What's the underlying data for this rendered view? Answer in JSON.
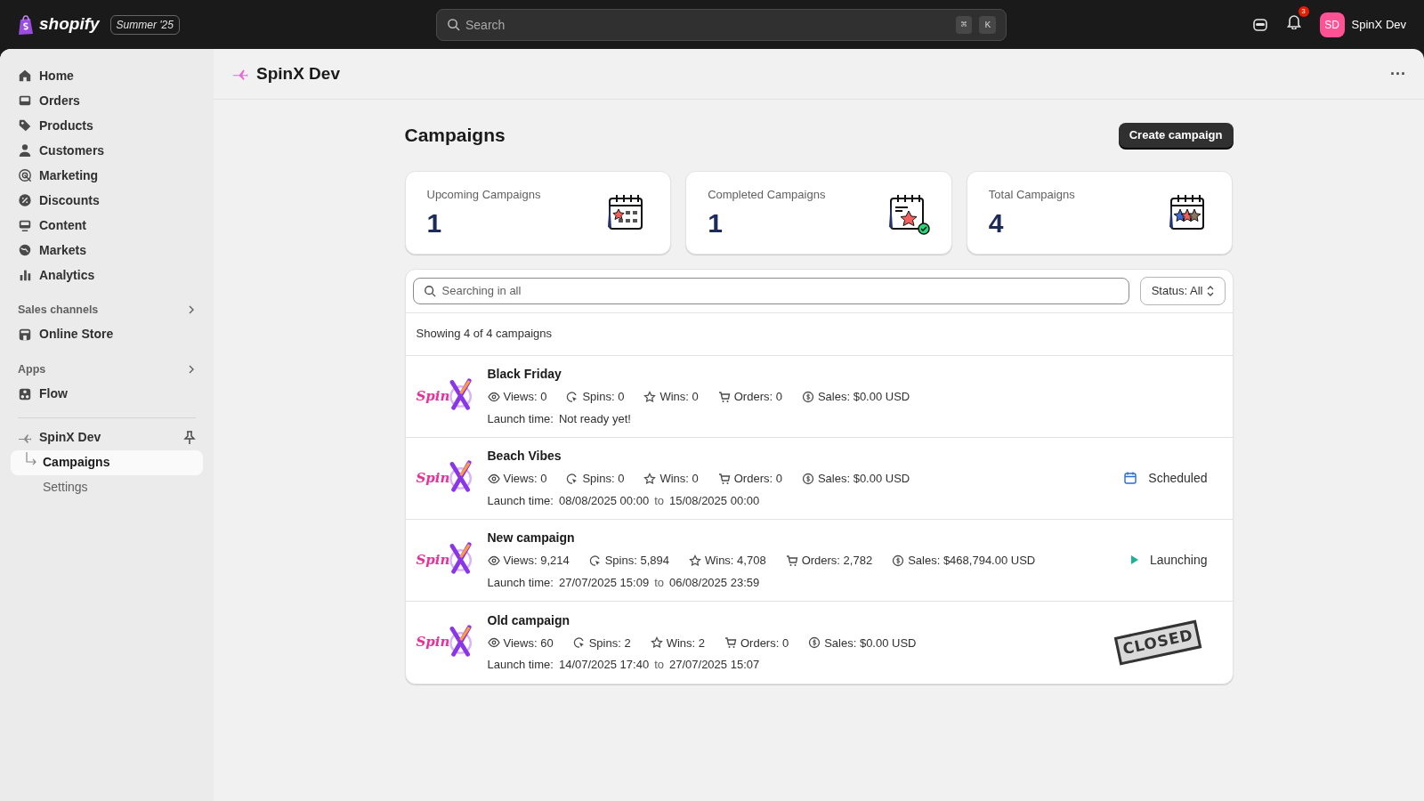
{
  "topbar": {
    "brand": "shopify",
    "edition": "Summer '25",
    "search": {
      "placeholder": "Search",
      "shortcut": [
        "⌘",
        "K"
      ]
    },
    "notifications": "3",
    "user": {
      "initials": "SD",
      "name": "SpinX Dev"
    }
  },
  "sidebar": {
    "items": [
      {
        "label": "Home",
        "selected": false
      },
      {
        "label": "Orders",
        "selected": false
      },
      {
        "label": "Products",
        "selected": false
      },
      {
        "label": "Customers",
        "selected": false
      },
      {
        "label": "Marketing",
        "selected": false
      },
      {
        "label": "Discounts",
        "selected": false
      },
      {
        "label": "Content",
        "selected": false
      },
      {
        "label": "Markets",
        "selected": false
      },
      {
        "label": "Analytics",
        "selected": false
      }
    ],
    "sections": [
      {
        "title": "Sales channels",
        "items": [
          {
            "label": "Online Store",
            "selected": false
          }
        ]
      },
      {
        "title": "Apps",
        "items": [
          {
            "label": "Flow",
            "selected": false
          }
        ]
      }
    ],
    "app": {
      "label": "SpinX Dev",
      "children": [
        {
          "label": "Campaigns",
          "selected": true
        },
        {
          "label": "Settings",
          "selected": false
        }
      ]
    }
  },
  "app_header": {
    "title": "SpinX Dev",
    "menu": "···"
  },
  "page": {
    "title": "Campaigns",
    "primary_button": "Create campaign"
  },
  "stats": [
    {
      "label": "Upcoming Campaigns",
      "value": "1"
    },
    {
      "label": "Completed Campaigns",
      "value": "1"
    },
    {
      "label": "Total Campaigns",
      "value": "4"
    }
  ],
  "filters": {
    "search_placeholder": "Searching in all",
    "status_filter": "Status: All"
  },
  "summary": "Showing 4 of 4 campaigns",
  "campaigns": [
    {
      "logo": "Spin",
      "name": "Black Friday",
      "metrics": [
        {
          "kind": "views",
          "text": "Views: 0"
        },
        {
          "kind": "spins",
          "text": "Spins: 0"
        },
        {
          "kind": "wins",
          "text": "Wins: 0"
        },
        {
          "kind": "orders",
          "text": "Orders: 0"
        },
        {
          "kind": "sales",
          "text": "Sales: $0.00 USD"
        }
      ],
      "launch_label": "Launch time:",
      "launch": [
        "Not ready yet!"
      ],
      "status": {
        "kind": "none"
      }
    },
    {
      "logo": "Spin",
      "name": "Beach Vibes",
      "metrics": [
        {
          "kind": "views",
          "text": "Views: 0"
        },
        {
          "kind": "spins",
          "text": "Spins: 0"
        },
        {
          "kind": "wins",
          "text": "Wins: 0"
        },
        {
          "kind": "orders",
          "text": "Orders: 0"
        },
        {
          "kind": "sales",
          "text": "Sales: $0.00 USD"
        }
      ],
      "launch_label": "Launch time:",
      "launch": [
        "08/08/2025 00:00",
        "to",
        "15/08/2025 00:00"
      ],
      "status": {
        "kind": "scheduled",
        "text": "Scheduled"
      }
    },
    {
      "logo": "Spin",
      "name": "New campaign",
      "metrics": [
        {
          "kind": "views",
          "text": "Views: 9,214"
        },
        {
          "kind": "spins",
          "text": "Spins: 5,894"
        },
        {
          "kind": "wins",
          "text": "Wins: 4,708"
        },
        {
          "kind": "orders",
          "text": "Orders: 2,782"
        },
        {
          "kind": "sales",
          "text": "Sales: $468,794.00 USD"
        }
      ],
      "launch_label": "Launch time:",
      "launch": [
        "27/07/2025 15:09",
        "to",
        "06/08/2025 23:59"
      ],
      "status": {
        "kind": "launching",
        "text": "Launching"
      }
    },
    {
      "logo": "Spin",
      "name": "Old campaign",
      "metrics": [
        {
          "kind": "views",
          "text": "Views: 60"
        },
        {
          "kind": "spins",
          "text": "Spins: 2"
        },
        {
          "kind": "wins",
          "text": "Wins: 2"
        },
        {
          "kind": "orders",
          "text": "Orders: 0"
        },
        {
          "kind": "sales",
          "text": "Sales: $0.00 USD"
        }
      ],
      "launch_label": "Launch time:",
      "launch": [
        "14/07/2025 17:40",
        "to",
        "27/07/2025 15:07"
      ],
      "status": {
        "kind": "closed",
        "text": "CLOSED"
      }
    }
  ]
}
